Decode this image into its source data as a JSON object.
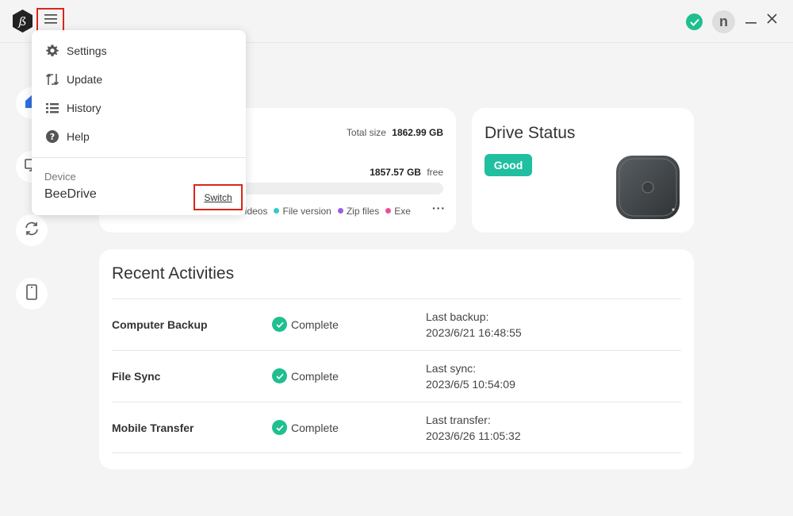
{
  "app": {
    "title": "BeeDrive",
    "avatar_letter": "n",
    "accent_color": "#1fbf8f",
    "highlight_color": "#d9261c",
    "icons": {
      "logo": "beedrive-logo-icon",
      "menu": "hamburger-menu-icon",
      "status": "check-circle-icon",
      "minimize": "minimize-icon",
      "close": "close-icon"
    }
  },
  "sidebar": {
    "items": [
      {
        "name": "home",
        "icon": "home-icon"
      },
      {
        "name": "computer-backup",
        "icon": "monitor-icon"
      },
      {
        "name": "file-sync",
        "icon": "sync-icon"
      },
      {
        "name": "mobile-transfer",
        "icon": "phone-icon"
      }
    ]
  },
  "menu": {
    "items": [
      {
        "label": "Settings",
        "icon": "gear-icon"
      },
      {
        "label": "Update",
        "icon": "update-icon"
      },
      {
        "label": "History",
        "icon": "list-icon"
      },
      {
        "label": "Help",
        "icon": "help-icon"
      }
    ],
    "device_label": "Device",
    "device_name": "BeeDrive",
    "switch_label": "Switch"
  },
  "storage": {
    "total_label": "Total size",
    "total_value": "1862.99 GB",
    "free_value": "1857.57 GB",
    "free_label": "free",
    "legend": [
      {
        "label": "Videos",
        "color": "#4a7bd8"
      },
      {
        "label": "File version",
        "color": "#35c9c4"
      },
      {
        "label": "Zip files",
        "color": "#9a5de0"
      },
      {
        "label": "Exe",
        "color": "#e84f9a"
      }
    ],
    "more_label": "···"
  },
  "drive_status": {
    "title": "Drive Status",
    "badge": "Good",
    "badge_color": "#1fbf9f"
  },
  "recent": {
    "title": "Recent Activities",
    "rows": [
      {
        "name": "Computer Backup",
        "status": "Complete",
        "time_label": "Last backup:",
        "time": "2023/6/21 16:48:55"
      },
      {
        "name": "File Sync",
        "status": "Complete",
        "time_label": "Last sync:",
        "time": "2023/6/5 10:54:09"
      },
      {
        "name": "Mobile Transfer",
        "status": "Complete",
        "time_label": "Last transfer:",
        "time": "2023/6/26 11:05:32"
      }
    ]
  }
}
